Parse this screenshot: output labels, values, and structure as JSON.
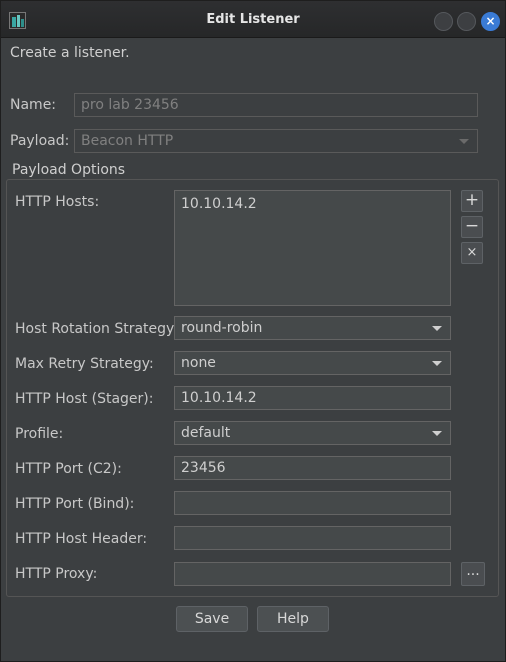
{
  "window": {
    "title": "Edit Listener"
  },
  "intro": "Create a listener.",
  "name": {
    "label": "Name:",
    "value": "pro lab 23456"
  },
  "payload": {
    "label": "Payload:",
    "value": "Beacon HTTP"
  },
  "group": {
    "title": "Payload Options"
  },
  "http_hosts": {
    "label": "HTTP Hosts:",
    "items": [
      "10.10.14.2"
    ],
    "add_icon": "+",
    "remove_icon": "−",
    "clear_icon": "×"
  },
  "host_rotation": {
    "label": "Host Rotation Strategy:",
    "value": "round-robin"
  },
  "max_retry": {
    "label": "Max Retry Strategy:",
    "value": "none"
  },
  "http_host_stager": {
    "label": "HTTP Host (Stager):",
    "value": "10.10.14.2"
  },
  "profile": {
    "label": "Profile:",
    "value": "default"
  },
  "http_port_c2": {
    "label": "HTTP Port (C2):",
    "value": "23456"
  },
  "http_port_bind": {
    "label": "HTTP Port (Bind):",
    "value": ""
  },
  "http_host_header": {
    "label": "HTTP Host Header:",
    "value": ""
  },
  "http_proxy": {
    "label": "HTTP Proxy:",
    "value": "",
    "browse_label": "..."
  },
  "buttons": {
    "save": "Save",
    "help": "Help"
  }
}
